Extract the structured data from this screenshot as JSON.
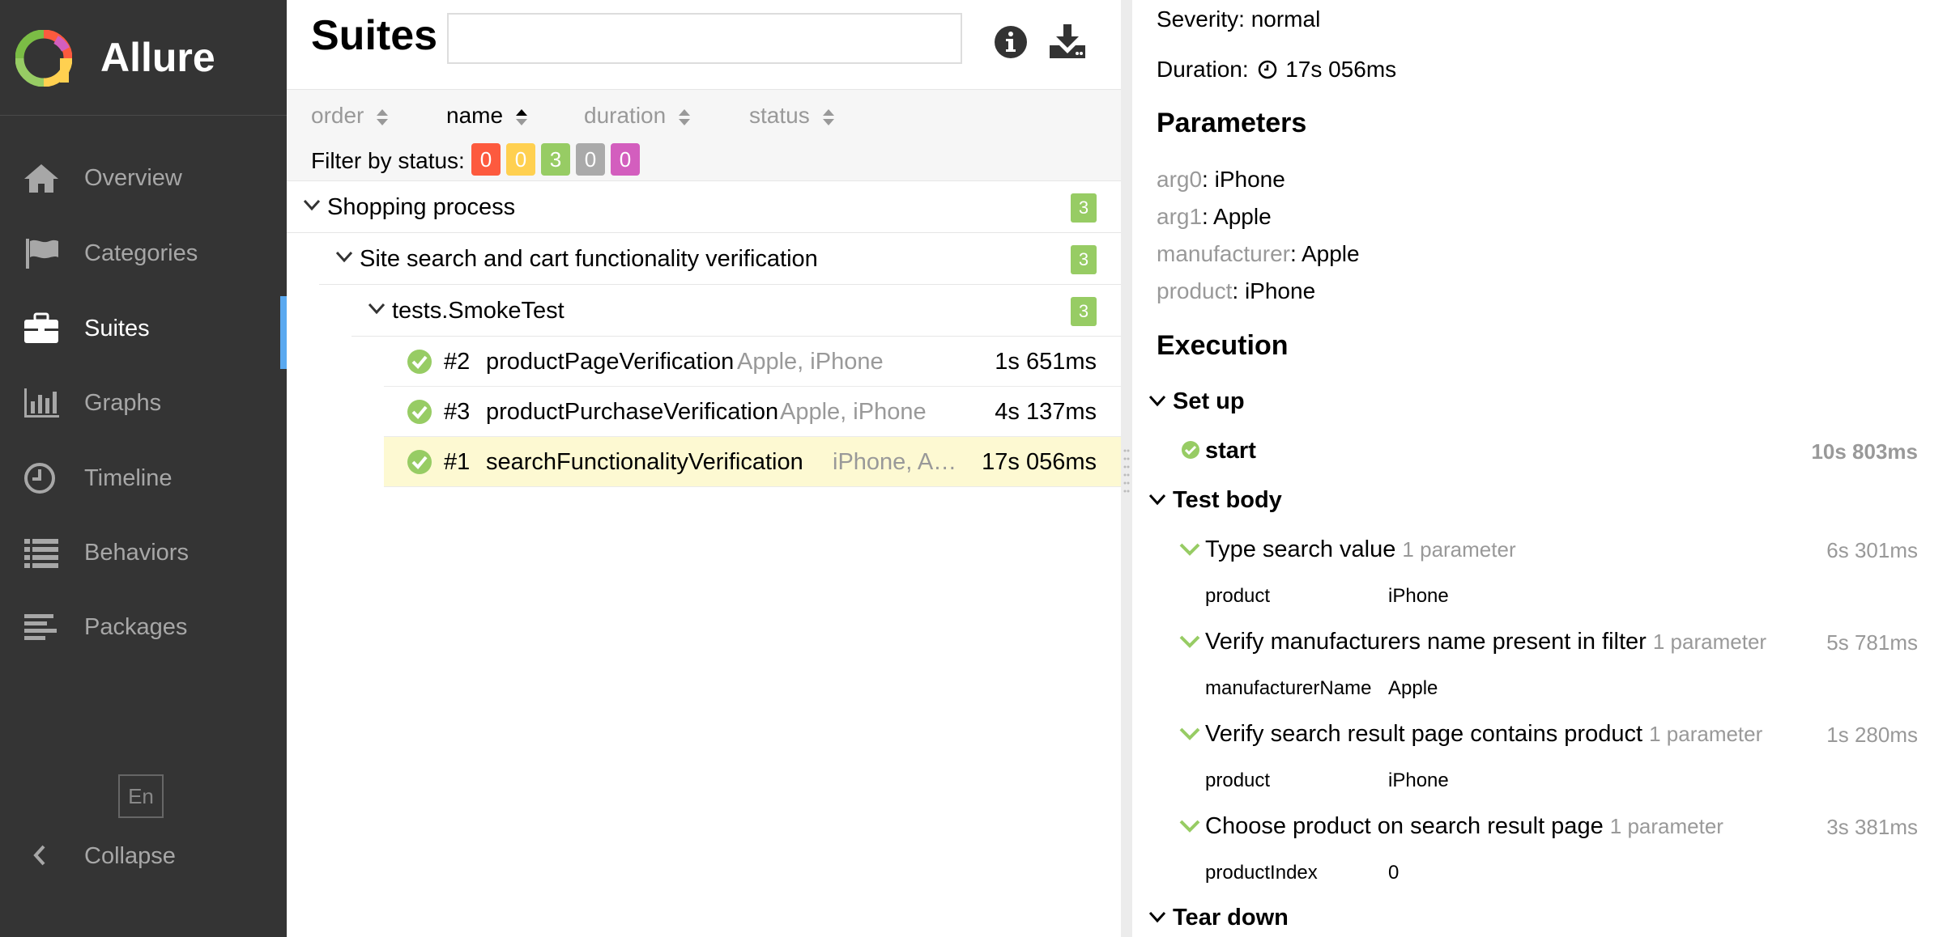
{
  "brand": {
    "name": "Allure"
  },
  "sidebar": {
    "items": [
      {
        "label": "Overview",
        "icon": "home-icon",
        "active": false
      },
      {
        "label": "Categories",
        "icon": "flag-icon",
        "active": false
      },
      {
        "label": "Suites",
        "icon": "briefcase-icon",
        "active": true
      },
      {
        "label": "Graphs",
        "icon": "bar-chart-icon",
        "active": false
      },
      {
        "label": "Timeline",
        "icon": "clock-icon",
        "active": false
      },
      {
        "label": "Behaviors",
        "icon": "list-icon",
        "active": false
      },
      {
        "label": "Packages",
        "icon": "align-left-icon",
        "active": false
      }
    ],
    "language": "En",
    "collapse_label": "Collapse"
  },
  "suites": {
    "title": "Suites",
    "search": {
      "value": "",
      "placeholder": ""
    },
    "sort": [
      "order",
      "name",
      "duration",
      "status"
    ],
    "active_sort": "name",
    "filter_label": "Filter by status:",
    "status_counts": [
      {
        "value": "0",
        "color": "#fd5a3e"
      },
      {
        "value": "0",
        "color": "#ffd050"
      },
      {
        "value": "3",
        "color": "#97cc64"
      },
      {
        "value": "0",
        "color": "#aaaaaa"
      },
      {
        "value": "0",
        "color": "#d35ebe"
      }
    ],
    "groups": [
      {
        "name": "Shopping process",
        "count": "3"
      },
      {
        "name": "Site search and cart functionality verification",
        "count": "3"
      },
      {
        "name": "tests.SmokeTest",
        "count": "3"
      }
    ],
    "tests": [
      {
        "num": "#2",
        "name": "productPageVerification",
        "params": "Apple, iPhone",
        "duration": "1s 651ms",
        "selected": false
      },
      {
        "num": "#3",
        "name": "productPurchaseVerification",
        "params": "Apple, iPhone",
        "duration": "4s 137ms",
        "selected": false
      },
      {
        "num": "#1",
        "name": "searchFunctionalityVerification",
        "params": "iPhone, A…",
        "duration": "17s 056ms",
        "selected": true
      }
    ]
  },
  "details": {
    "severity": "Severity: normal",
    "duration_label": "Duration:",
    "duration_value": "17s 056ms",
    "parameters_heading": "Parameters",
    "parameters": [
      {
        "key": "arg0",
        "value": ": iPhone"
      },
      {
        "key": "arg1",
        "value": ": Apple"
      },
      {
        "key": "manufacturer",
        "value": ": Apple"
      },
      {
        "key": "product",
        "value": ": iPhone"
      }
    ],
    "execution_heading": "Execution",
    "setup": {
      "label": "Set up",
      "step": "start",
      "duration": "10s 803ms"
    },
    "test_body": {
      "label": "Test body",
      "steps": [
        {
          "title": "Type search value",
          "param_note": "1 parameter",
          "duration": "6s 301ms",
          "param_key": "product",
          "param_value": "iPhone"
        },
        {
          "title": "Verify manufacturers name present in filter",
          "param_note": "1 parameter",
          "duration": "5s 781ms",
          "param_key": "manufacturerName",
          "param_value": "Apple"
        },
        {
          "title": "Verify search result page contains product",
          "param_note": "1 parameter",
          "duration": "1s 280ms",
          "param_key": "product",
          "param_value": "iPhone"
        },
        {
          "title": "Choose product on search result page",
          "param_note": "1 parameter",
          "duration": "3s 381ms",
          "param_key": "productIndex",
          "param_value": "0"
        }
      ]
    },
    "teardown": {
      "label": "Tear down"
    }
  }
}
